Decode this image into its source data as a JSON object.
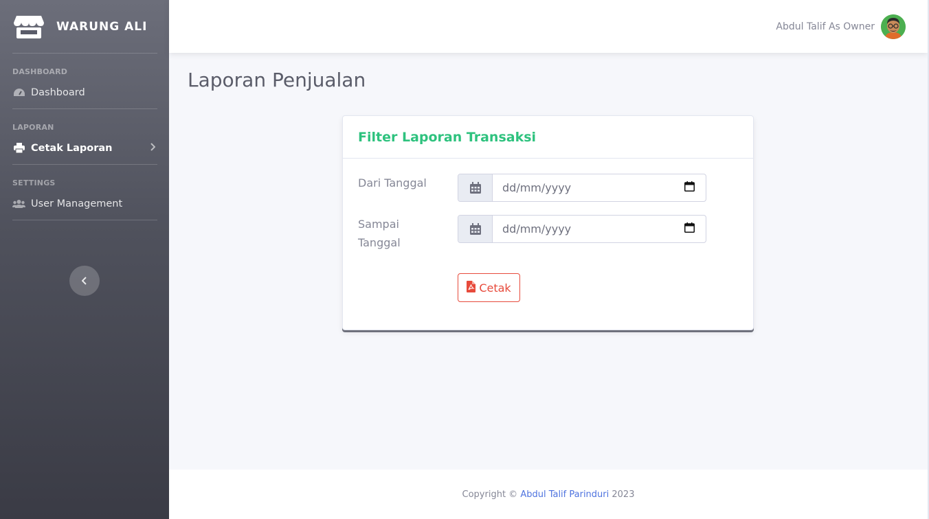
{
  "brand": {
    "name": "WARUNG ALI",
    "icon": "store-icon"
  },
  "sidebar": {
    "sections": [
      {
        "heading": "DASHBOARD",
        "items": [
          {
            "label": "Dashboard",
            "icon": "tachometer-icon",
            "active": false
          }
        ]
      },
      {
        "heading": "LAPORAN",
        "items": [
          {
            "label": "Cetak Laporan",
            "icon": "print-icon",
            "active": true
          }
        ]
      },
      {
        "heading": "SETTINGS",
        "items": [
          {
            "label": "User Management",
            "icon": "users-icon",
            "active": false
          }
        ]
      }
    ],
    "toggle_icon": "chevron-left-icon"
  },
  "topbar": {
    "user_name": "Abdul Talif As Owner",
    "avatar_icon": "avatar"
  },
  "page": {
    "title": "Laporan Penjualan"
  },
  "card": {
    "title": "Filter Laporan Transaksi",
    "fields": [
      {
        "label": "Dari Tanggal",
        "placeholder": "dd/mm/yyyy"
      },
      {
        "label": "Sampai Tanggal",
        "placeholder": "dd/mm/yyyy"
      }
    ],
    "button_label": "Cetak"
  },
  "footer": {
    "prefix": "Copyright ©",
    "author": "Abdul Talif Parinduri",
    "year": "2023"
  },
  "colors": {
    "accent_green": "#2ec27e",
    "danger": "#e74a3b",
    "link": "#4e73df"
  }
}
